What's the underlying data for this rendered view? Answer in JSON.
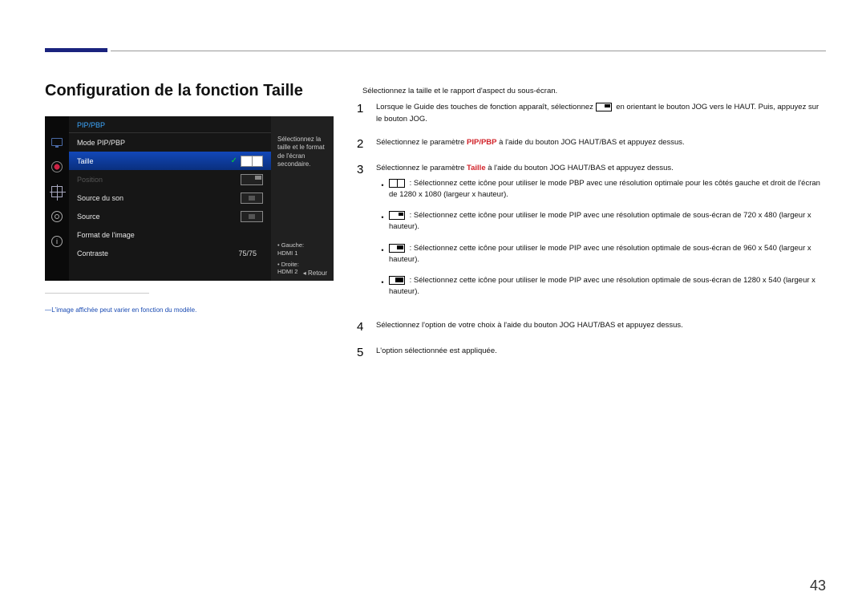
{
  "title": "Configuration de la fonction Taille",
  "page_number": "43",
  "osd": {
    "header": "PIP/PBP",
    "rows": {
      "mode": "Mode PIP/PBP",
      "taille": "Taille",
      "position": "Position",
      "source_son": "Source du son",
      "source": "Source",
      "format": "Format de l'image",
      "contraste": "Contraste",
      "contraste_val": "75/75"
    },
    "side_desc": "Sélectionnez la taille et le format de l'écran secondaire.",
    "gauche_label": "Gauche:",
    "gauche_val": "HDMI 1",
    "droite_label": "Droite:",
    "droite_val": "HDMI 2",
    "retour": "Retour"
  },
  "note": "L'image affichée peut varier en fonction du modèle.",
  "intro": "Sélectionnez la taille et le rapport d'aspect du sous-écran.",
  "steps": {
    "s1a": "Lorsque le Guide des touches de fonction apparaît, sélectionnez ",
    "s1b": " en orientant le bouton JOG vers le HAUT. Puis, appuyez sur le bouton JOG.",
    "s2a": "Sélectionnez le paramètre ",
    "s2_pip": "PIP/PBP",
    "s2b": " à l'aide du bouton JOG HAUT/BAS et appuyez dessus.",
    "s3a": "Sélectionnez le paramètre ",
    "s3_taille": "Taille",
    "s3b": " à l'aide du bouton JOG HAUT/BAS et appuyez dessus.",
    "b1": " : Sélectionnez cette icône pour utiliser le mode PBP avec une résolution optimale pour les côtés gauche et droit de l'écran de 1280 x 1080 (largeur x hauteur).",
    "b2": " : Sélectionnez cette icône pour utiliser le mode PIP avec une résolution optimale de sous-écran de 720 x 480 (largeur x hauteur).",
    "b3": " : Sélectionnez cette icône pour utiliser le mode PIP avec une résolution optimale de sous-écran de 960 x 540 (largeur x hauteur).",
    "b4": " : Sélectionnez cette icône pour utiliser le mode PIP avec une résolution optimale de sous-écran de 1280 x 540 (largeur x hauteur).",
    "s4": "Sélectionnez l'option de votre choix à l'aide du bouton JOG HAUT/BAS et appuyez dessus.",
    "s5": "L'option sélectionnée est appliquée."
  }
}
